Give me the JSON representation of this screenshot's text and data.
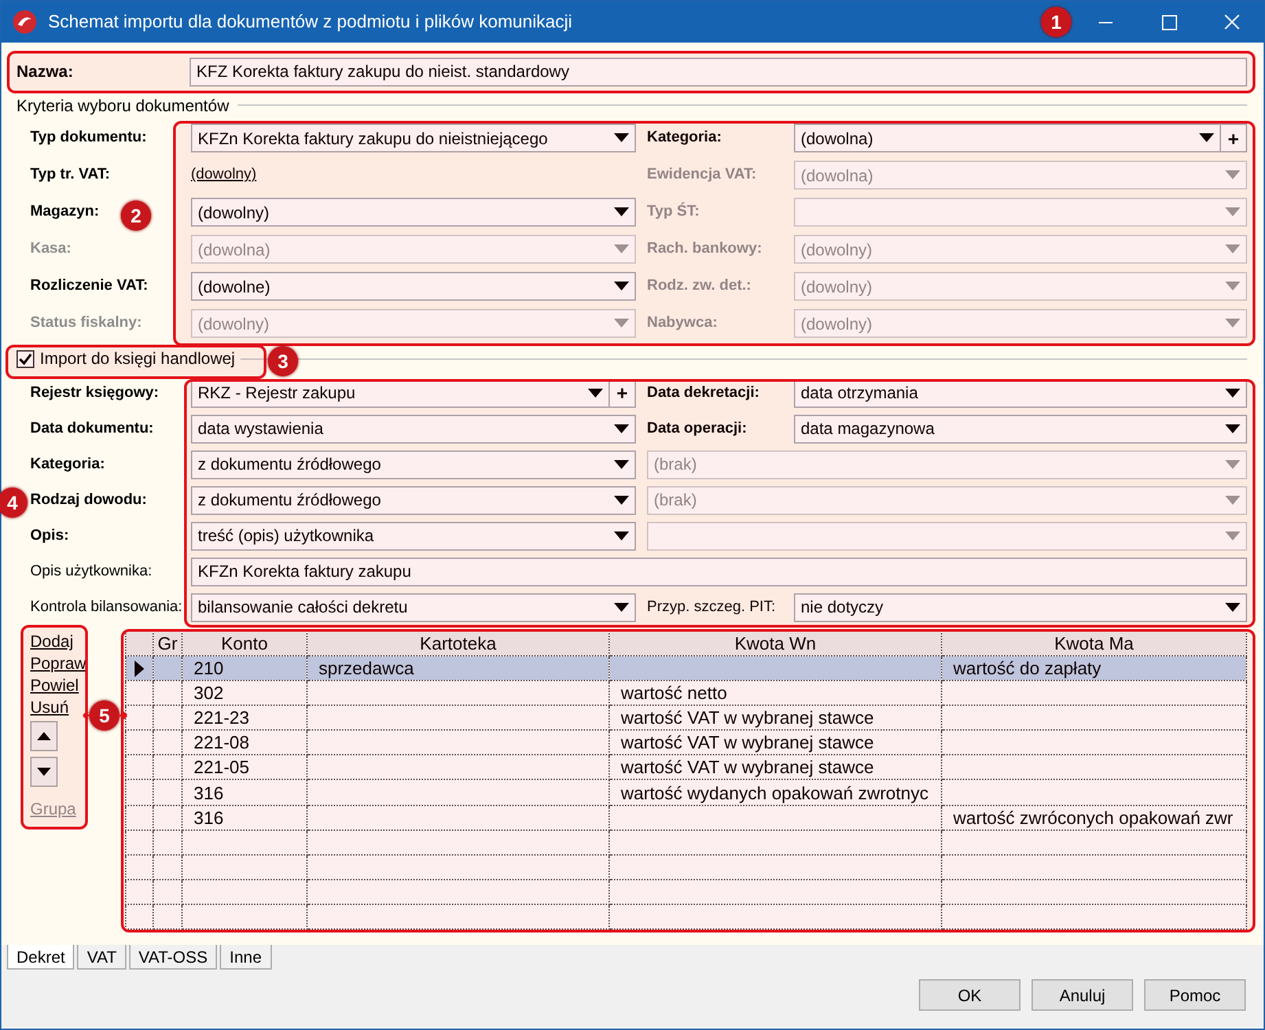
{
  "window": {
    "title": "Schemat importu dla dokumentów z podmiotu i plików komunikacji"
  },
  "name_field": {
    "label": "Nazwa:",
    "value": "KFZ Korekta faktury zakupu do nieist. standardowy"
  },
  "criteria": {
    "title": "Kryteria wyboru dokumentów",
    "rows": [
      {
        "left": {
          "label": "Typ dokumentu:",
          "required": true,
          "kind": "combo",
          "value": "KFZn Korekta faktury zakupu do nieistniejącego",
          "disabled": false
        },
        "right": {
          "label": "Kategoria:",
          "required": true,
          "kind": "combo",
          "value": "(dowolna)",
          "disabled": false,
          "add_button": "+"
        }
      },
      {
        "left": {
          "label": "Typ tr. VAT:",
          "required": true,
          "kind": "link",
          "value": "(dowolny)",
          "disabled": false
        },
        "right": {
          "label": "Ewidencja VAT:",
          "required": true,
          "kind": "combo",
          "value": "(dowolna)",
          "disabled": true
        }
      },
      {
        "left": {
          "label": "Magazyn:",
          "required": true,
          "kind": "combo",
          "value": "(dowolny)",
          "disabled": false
        },
        "right": {
          "label": "Typ ŚT:",
          "required": true,
          "kind": "combo",
          "disabled": true
        }
      },
      {
        "left": {
          "label": "Kasa:",
          "required": true,
          "kind": "combo",
          "value": "(dowolna)",
          "disabled": true
        },
        "right": {
          "label": "Rach. bankowy:",
          "required": true,
          "kind": "combo",
          "value": "(dowolny)",
          "disabled": true
        }
      },
      {
        "left": {
          "label": "Rozliczenie VAT:",
          "required": true,
          "kind": "combo",
          "value": "(dowolne)",
          "disabled": false
        },
        "right": {
          "label": "Rodz. zw. det.:",
          "required": true,
          "kind": "combo",
          "value": "(dowolny)",
          "disabled": true
        }
      },
      {
        "left": {
          "label": "Status fiskalny:",
          "required": true,
          "kind": "combo",
          "value": "(dowolny)",
          "disabled": true
        },
        "right": {
          "label": "Nabywca:",
          "required": true,
          "kind": "combo",
          "value": "(dowolny)",
          "disabled": true
        }
      }
    ]
  },
  "import": {
    "label": "Import do księgi handlowej",
    "checked": true,
    "rows": [
      {
        "left": {
          "label": "Rejestr księgowy:",
          "required": true,
          "kind": "combo",
          "value": "RKZ - Rejestr zakupu",
          "disabled": false,
          "add_button": "+"
        },
        "right": {
          "label": "Data dekretacji:",
          "required": true,
          "kind": "combo",
          "value": "data otrzymania",
          "disabled": false
        }
      },
      {
        "left": {
          "label": "Data dokumentu:",
          "required": true,
          "kind": "combo",
          "value": "data wystawienia",
          "disabled": false
        },
        "right": {
          "label": "Data operacji:",
          "required": true,
          "kind": "combo",
          "value": "data magazynowa",
          "disabled": false
        }
      },
      {
        "left": {
          "label": "Kategoria:",
          "required": true,
          "kind": "combo",
          "value": "z dokumentu źródłowego",
          "disabled": false
        },
        "right": {
          "kind": "combo",
          "value": "(brak)",
          "disabled": true
        }
      },
      {
        "left": {
          "label": "Rodzaj dowodu:",
          "required": true,
          "kind": "combo",
          "value": "z dokumentu źródłowego",
          "disabled": false
        },
        "right": {
          "kind": "combo",
          "value": "(brak)",
          "disabled": true
        }
      },
      {
        "left": {
          "label": "Opis:",
          "required": true,
          "kind": "combo",
          "value": "treść (opis) użytkownika",
          "disabled": false
        },
        "right": {
          "kind": "combo",
          "disabled": true
        }
      },
      {
        "left": {
          "label": "Opis użytkownika:",
          "required": false,
          "kind": "text",
          "value": "KFZn Korekta faktury zakupu",
          "disabled": false
        }
      },
      {
        "left": {
          "label": "Kontrola bilansowania:",
          "required": false,
          "kind": "combo",
          "value": "bilansowanie całości dekretu",
          "disabled": false
        },
        "right": {
          "label": "Przyp. szczeg. PIT:",
          "required": false,
          "kind": "combo",
          "value": "nie dotyczy",
          "disabled": false
        }
      }
    ]
  },
  "side_actions": [
    {
      "kind": "link",
      "label": "Dodaj",
      "disabled": false
    },
    {
      "kind": "link",
      "label": "Popraw",
      "disabled": false
    },
    {
      "kind": "link",
      "label": "Powiel",
      "disabled": false
    },
    {
      "kind": "link",
      "label": "Usuń",
      "disabled": false
    },
    {
      "kind": "up"
    },
    {
      "kind": "down"
    },
    {
      "kind": "link",
      "label": "Grupa",
      "disabled": true
    }
  ],
  "table": {
    "columns": [
      "Gr",
      "Konto",
      "Kartoteka",
      "Kwota Wn",
      "Kwota Ma"
    ],
    "rows": [
      {
        "selected": true,
        "konto": "210",
        "kartoteka": "sprzedawca",
        "kwota_ma": "wartość do zapłaty"
      },
      {
        "selected": false,
        "konto": "302",
        "kwota_wn": "wartość netto"
      },
      {
        "selected": false,
        "konto": "221-23",
        "kwota_wn": "wartość VAT w wybranej stawce"
      },
      {
        "selected": false,
        "konto": "221-08",
        "kwota_wn": "wartość VAT w wybranej stawce"
      },
      {
        "selected": false,
        "konto": "221-05",
        "kwota_wn": "wartość VAT w wybranej stawce"
      },
      {
        "selected": false,
        "konto": "316",
        "kwota_wn": "wartość wydanych opakowań zwrotnyc"
      },
      {
        "selected": false,
        "konto": "316",
        "kwota_ma": "wartość zwróconych opakowań zwr"
      }
    ]
  },
  "tabs": [
    {
      "label": "Dekret",
      "selected": true
    },
    {
      "label": "VAT",
      "selected": false
    },
    {
      "label": "VAT-OSS",
      "selected": false
    },
    {
      "label": "Inne",
      "selected": false
    }
  ],
  "buttons": [
    "OK",
    "Anuluj",
    "Pomoc"
  ],
  "annotations": [
    "1",
    "2",
    "3",
    "4",
    "5"
  ]
}
